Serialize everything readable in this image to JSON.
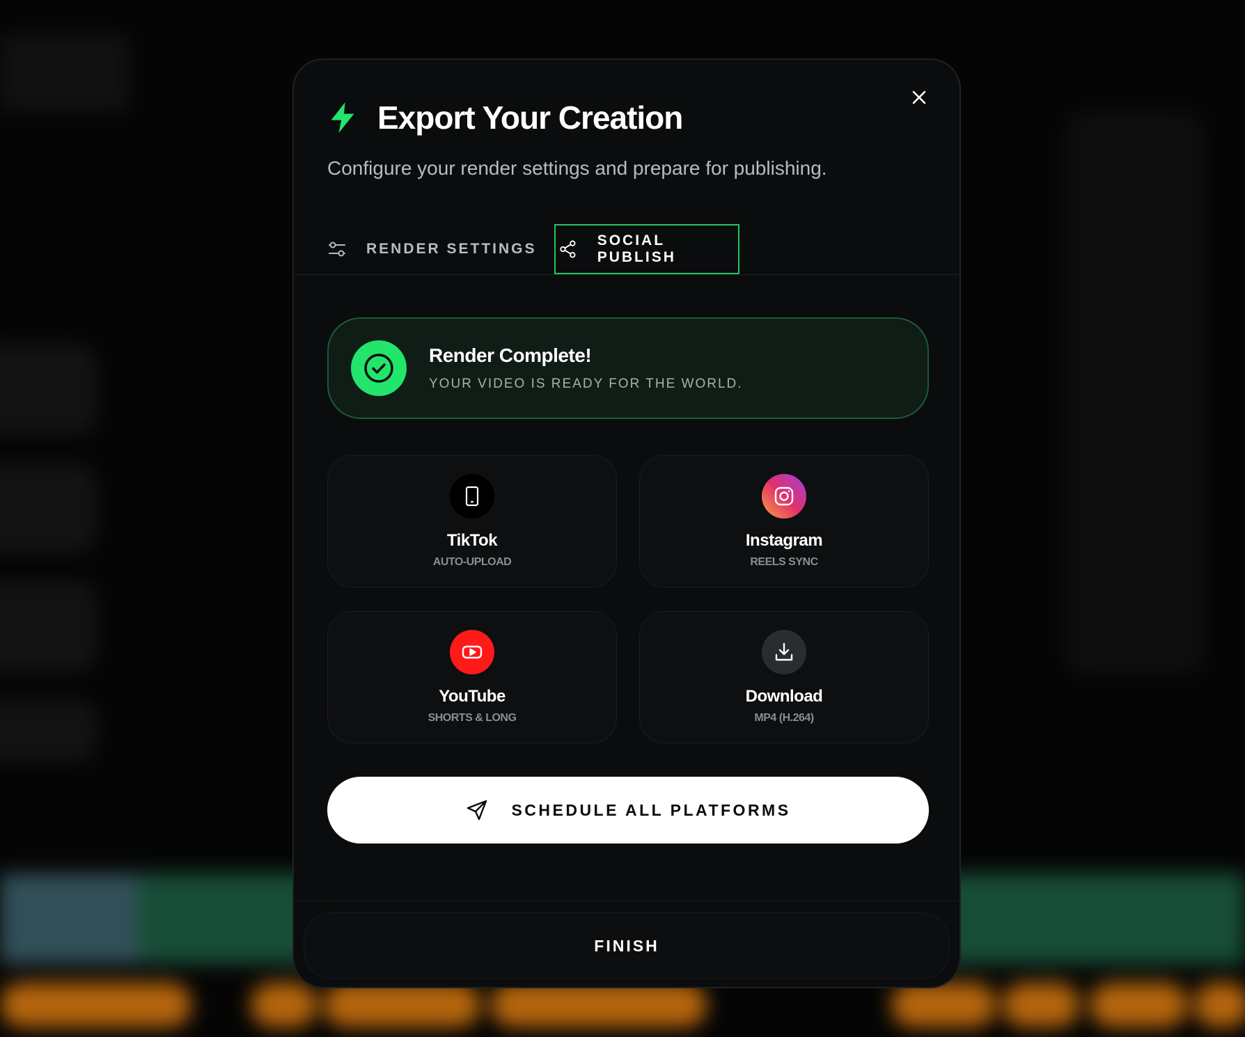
{
  "modal": {
    "title": "Export Your Creation",
    "subtitle": "Configure your render settings and prepare for publishing.",
    "title_icon": "lightning-bolt-icon",
    "accent_color": "#22e56b"
  },
  "tabs": [
    {
      "label": "RENDER SETTINGS",
      "icon": "sliders-icon",
      "active": false
    },
    {
      "label": "SOCIAL PUBLISH",
      "icon": "share-icon",
      "active": true
    }
  ],
  "banner": {
    "title": "Render Complete!",
    "subtitle": "YOUR VIDEO IS READY FOR THE WORLD.",
    "icon": "check-circle-icon"
  },
  "platforms": [
    {
      "name": "TikTok",
      "sub": "AUTO-UPLOAD",
      "icon": "phone-icon",
      "color": "#000000"
    },
    {
      "name": "Instagram",
      "sub": "REELS SYNC",
      "icon": "instagram-icon",
      "color": "#e1306c"
    },
    {
      "name": "YouTube",
      "sub": "SHORTS & LONG",
      "icon": "youtube-icon",
      "color": "#ff0000"
    },
    {
      "name": "Download",
      "sub": "MP4 (H.264)",
      "icon": "download-icon",
      "color": "#2a2d30"
    }
  ],
  "schedule_button": {
    "label": "SCHEDULE ALL PLATFORMS",
    "icon": "send-icon"
  },
  "finish_button": {
    "label": "FINISH"
  }
}
